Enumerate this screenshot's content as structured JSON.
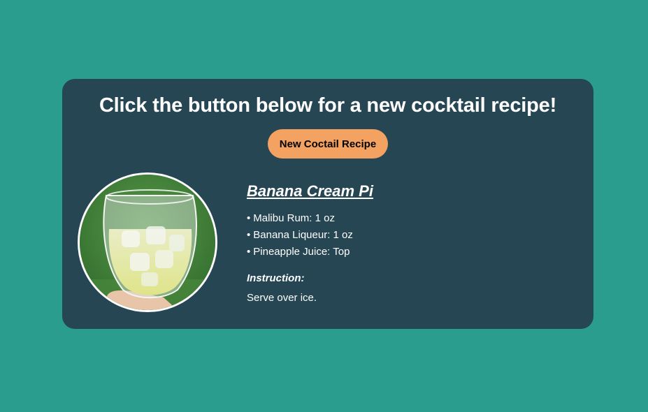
{
  "header": {
    "title": "Click the button below for a new cocktail recipe!"
  },
  "actions": {
    "new_recipe_label": "New Coctail Recipe"
  },
  "recipe": {
    "name": "Banana Cream Pi",
    "ingredients": [
      "Malibu Rum: 1 oz",
      "Banana Liqueur: 1 oz",
      "Pineapple Juice: Top"
    ],
    "instruction_label": "Instruction:",
    "instruction_text": "Serve over ice."
  },
  "colors": {
    "page_background": "#2a9d8f",
    "card_background": "#264653",
    "button_background": "#f4a261",
    "text": "#ffffff"
  }
}
